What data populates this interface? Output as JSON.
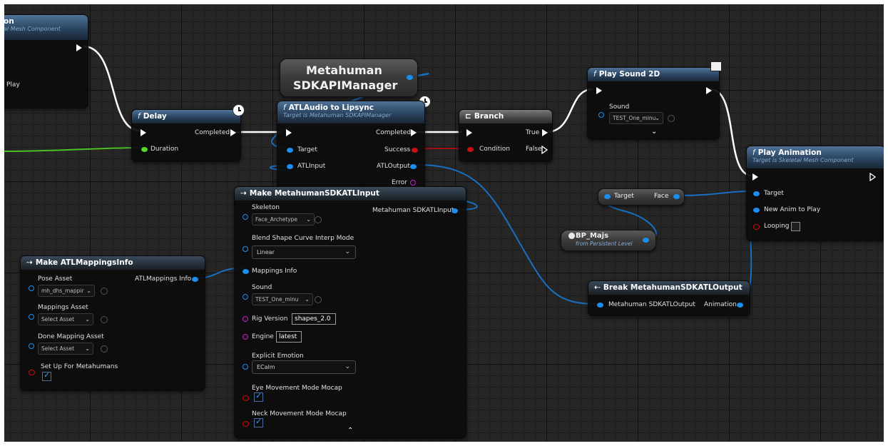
{
  "nodes": {
    "event": {
      "title": "on",
      "subtitle": "al Mesh Component",
      "play_label": "Play"
    },
    "delay": {
      "title": "Delay",
      "completed": "Completed",
      "duration": "Duration"
    },
    "metahuman_var": {
      "line1": "Metahuman",
      "line2": "SDKAPIManager"
    },
    "atl": {
      "title": "ATLAudio to Lipsync",
      "subtitle": "Target is Metahuman SDKAPIManager",
      "completed": "Completed",
      "target": "Target",
      "success": "Success",
      "atlinput": "ATLInput",
      "atloutput": "ATLOutput",
      "error": "Error"
    },
    "branch": {
      "title": "Branch",
      "condition": "Condition",
      "true_label": "True",
      "false_label": "False"
    },
    "play_sound": {
      "title": "Play Sound 2D",
      "sound": "Sound",
      "sound_value": "TEST_One_minu"
    },
    "play_anim": {
      "title": "Play Animation",
      "subtitle": "Target is Skeletal Mesh Component",
      "target": "Target",
      "new_anim": "New Anim to Play",
      "looping": "Looping"
    },
    "face_get": {
      "target": "Target",
      "face": "Face"
    },
    "bp_majs": {
      "title": "BP_Majs",
      "subtitle": "from Persistent Level"
    },
    "break_output": {
      "title": "Break MetahumanSDKATLOutput",
      "input": "Metahuman SDKATLOutput",
      "animation": "Animation"
    },
    "make_input": {
      "title": "Make MetahumanSDKATLInput",
      "skeleton": "Skeleton",
      "skeleton_value": "Face_Archetype",
      "output": "Metahuman SDKATLInput",
      "blend_mode": "Blend Shape Curve Interp Mode",
      "blend_value": "Linear",
      "mappings": "Mappings Info",
      "sound": "Sound",
      "sound_value": "TEST_One_minu",
      "rig_version": "Rig Version",
      "rig_value": "shapes_2.0",
      "engine": "Engine",
      "engine_value": "latest",
      "emotion": "Explicit Emotion",
      "emotion_value": "ECalm",
      "eye": "Eye Movement Mode Mocap",
      "neck": "Neck Movement Mode Mocap"
    },
    "make_mappings": {
      "title": "Make ATLMappingsInfo",
      "pose": "Pose Asset",
      "pose_value": "mh_dhs_mappir",
      "output": "ATLMappings Info",
      "mappings_asset": "Mappings Asset",
      "mappings_value": "Select Asset",
      "done_asset": "Done Mapping Asset",
      "done_value": "Select Asset",
      "setup": "Set Up For Metahumans"
    }
  },
  "glyphs": {
    "func": "f",
    "dropdown": "⌄",
    "collapse": "⌃"
  },
  "colors": {
    "exec": "#ffffff",
    "object": "#1d8ef0",
    "float": "#54d52a",
    "bool": "#c81010",
    "string": "#d020d0"
  }
}
